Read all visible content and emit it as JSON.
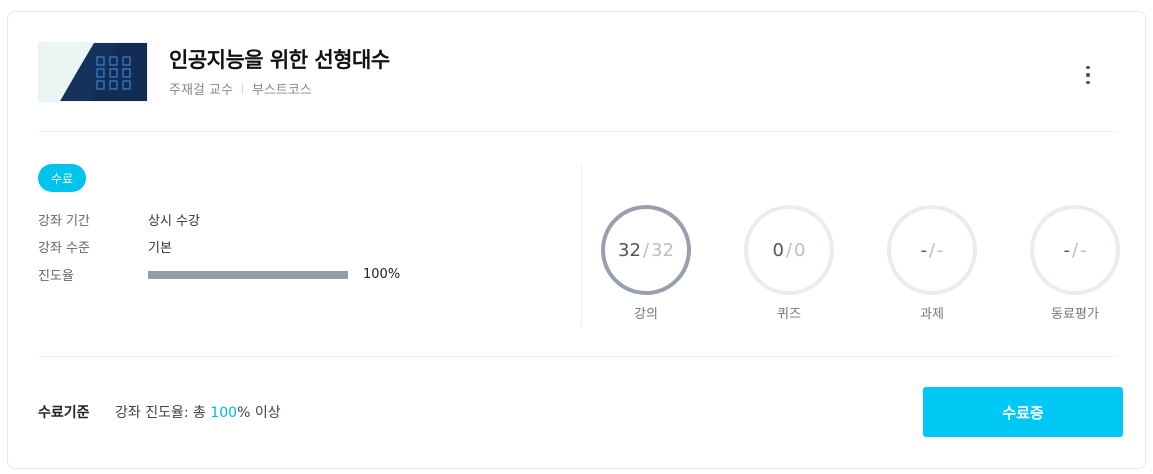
{
  "course": {
    "title": "인공지능을 위한 선형대수",
    "instructor": "주재걸 교수",
    "provider": "부스트코스",
    "thumbnail_icon": "binary-grid-icon"
  },
  "status": {
    "badge": "수료",
    "info": [
      {
        "label": "강좌 기간",
        "value": "상시 수강"
      },
      {
        "label": "강좌 수준",
        "value": "기본"
      }
    ],
    "progress_label": "진도율",
    "progress_percent": 100,
    "progress_text": "100%"
  },
  "stats": [
    {
      "label": "강의",
      "done": "32",
      "total": "32",
      "complete": true
    },
    {
      "label": "퀴즈",
      "done": "0",
      "total": "0",
      "complete": false
    },
    {
      "label": "과제",
      "done": "-",
      "total": "-",
      "complete": false
    },
    {
      "label": "동료평가",
      "done": "-",
      "total": "-",
      "complete": false
    }
  ],
  "criteria": {
    "label": "수료기준",
    "prefix": "강좌 진도율: 총 ",
    "value": "100",
    "suffix": "% 이상"
  },
  "cta_label": "수료증",
  "colors": {
    "accent": "#00c8f5",
    "progress": "#949ea8",
    "circle_done": "#98a1ab",
    "circle_empty": "#eaedf0"
  }
}
